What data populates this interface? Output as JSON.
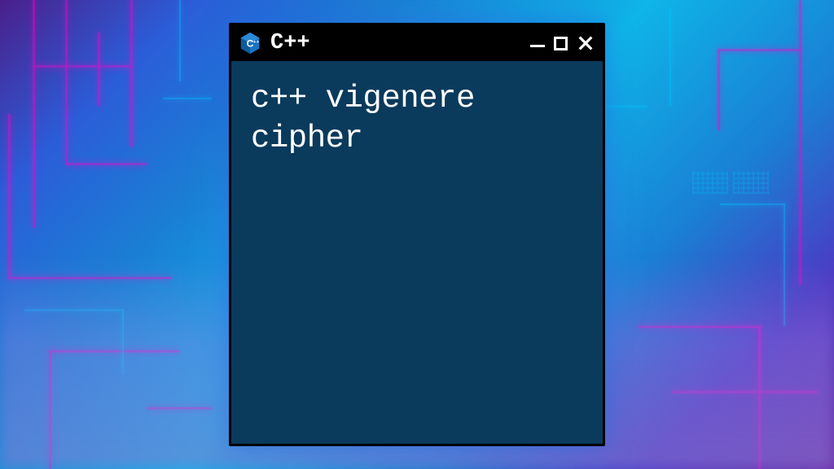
{
  "window": {
    "title": "C++",
    "icon_name": "cpp-logo-icon"
  },
  "content": {
    "line1": "c++ vigenere",
    "line2": "cipher"
  },
  "colors": {
    "window_bg": "#0a3a5c",
    "titlebar_bg": "#000000",
    "text": "#ffffff"
  }
}
